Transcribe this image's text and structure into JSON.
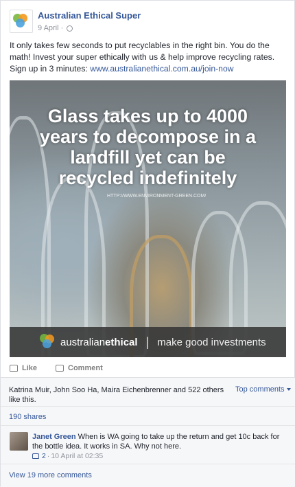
{
  "post": {
    "page_name": "Australian Ethical Super",
    "date": "9 April",
    "text": "It only takes few seconds to put recyclables in the right bin. You do the math! Invest your super ethically with us & help improve recycling rates. Sign up in 3 minutes: ",
    "link": "www.australianethical.com.au/join-now"
  },
  "image": {
    "headline_1": "Glass takes up to 4000",
    "headline_2": "years to decompose in a",
    "headline_3": "landfill yet can be",
    "headline_4": "recycled indefinitely",
    "source_url": "HTTP://WWW.ENVIRONMENT-GREEN.COM/",
    "brand_name_1": "australian",
    "brand_name_2": "ethical",
    "divider": "|",
    "tagline": "make good investments"
  },
  "actions": {
    "like": "Like",
    "comment": "Comment"
  },
  "summary": {
    "likes": "Katrina Muir, John Soo Ha, Maira Eichenbrenner and 522 others like this.",
    "top_comments": "Top comments",
    "shares": "190 shares",
    "view_more": "View 19 more comments"
  },
  "comment": {
    "author": "Janet Green",
    "text": " When is WA going to take up the return and get 10c back for the bottle idea. It works in SA. Why not here.",
    "likes": "2",
    "separator": "·",
    "time": "10 April at 02:35"
  },
  "colors": {
    "facebook_blue": "#365899",
    "logo_green": "#76b83f",
    "logo_orange": "#f39a1e",
    "logo_blue": "#4aa3df"
  },
  "icons": {
    "like": "thumbs-up-icon",
    "comment": "speech-bubble-icon",
    "privacy": "globe-icon",
    "dropdown": "chevron-down-icon"
  }
}
